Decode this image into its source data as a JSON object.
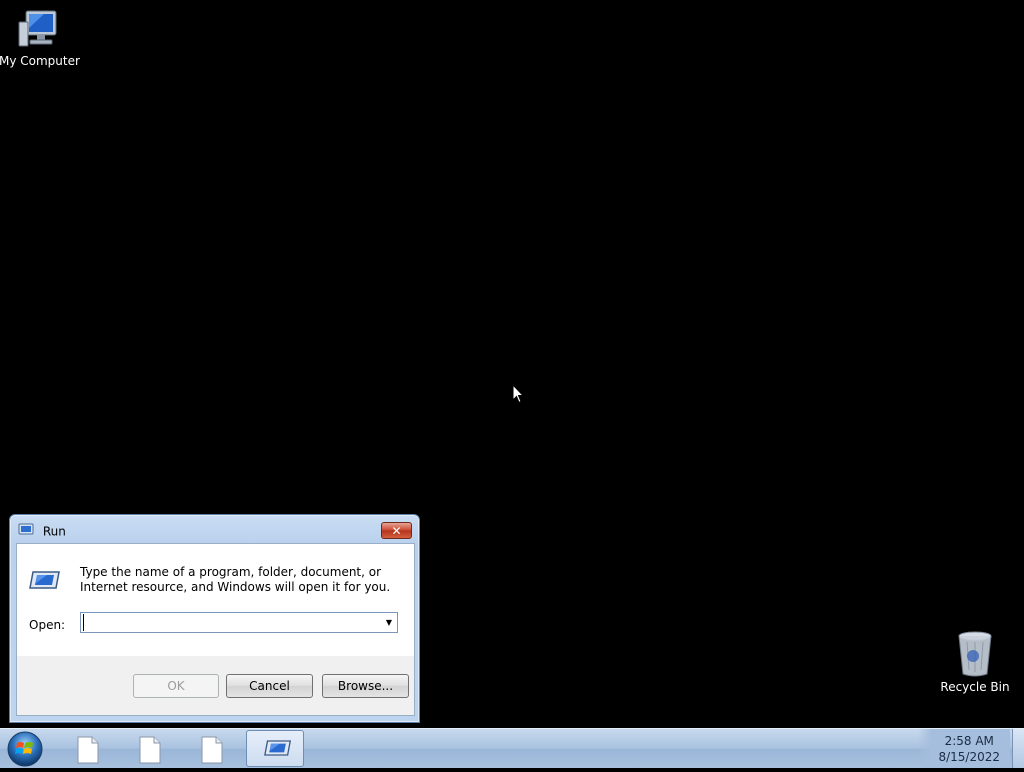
{
  "desktop": {
    "icons": [
      {
        "label": "My Computer",
        "icon": "computer-icon"
      },
      {
        "label": "Recycle Bin",
        "icon": "recycle-bin-icon"
      }
    ]
  },
  "run_dialog": {
    "title": "Run",
    "close_label": "✕",
    "description": "Type the name of a program, folder, document, or Internet resource, and Windows will open it for you.",
    "open_label": "Open:",
    "open_value": "",
    "ok_label": "OK",
    "cancel_label": "Cancel",
    "browse_label": "Browse..."
  },
  "taskbar": {
    "items": [
      {
        "icon": "document-icon"
      },
      {
        "icon": "document-icon"
      },
      {
        "icon": "document-icon"
      },
      {
        "icon": "run-icon",
        "active": true
      }
    ],
    "clock": {
      "time": "2:58 AM",
      "date": "8/15/2022"
    }
  }
}
